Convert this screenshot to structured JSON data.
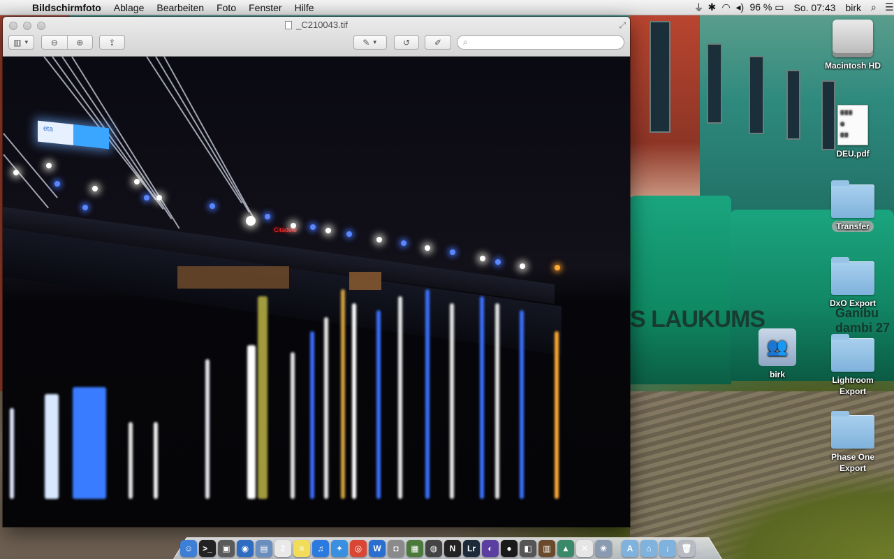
{
  "menubar": {
    "app_name": "Bildschirmfoto",
    "menus": [
      "Ablage",
      "Bearbeiten",
      "Foto",
      "Fenster",
      "Hilfe"
    ],
    "battery": "96 %",
    "clock": "So. 07:43",
    "user": "birk"
  },
  "window": {
    "title": "_C210043.tif",
    "search_placeholder": "",
    "photo_signs": {
      "sign_left": "eta",
      "sign_red": "Citadele"
    }
  },
  "desktop": {
    "wallpaper_text": "S LAUKUMS",
    "wallpaper_text2": "Ganibu dambi 27",
    "icons": [
      {
        "label": "Macintosh HD",
        "kind": "hd-icon"
      },
      {
        "label": "DEU.pdf",
        "kind": "pdf-icon"
      },
      {
        "label": "Transfer",
        "kind": "folder-icon"
      },
      {
        "label": "DxO Export",
        "kind": "folder-icon"
      },
      {
        "label": "birk",
        "kind": "home-icon"
      },
      {
        "label": "Lightroom Export",
        "kind": "folder-icon"
      },
      {
        "label": "Phase One Export",
        "kind": "folder-icon"
      }
    ]
  },
  "dock": {
    "apps": [
      {
        "name": "finder-icon",
        "glyph": "☺",
        "color": "#3d7fd6"
      },
      {
        "name": "terminal-icon",
        "glyph": ">_",
        "color": "#222"
      },
      {
        "name": "photo-booth-icon",
        "glyph": "▣",
        "color": "#5a5a5a"
      },
      {
        "name": "browser-icon",
        "glyph": "◉",
        "color": "#2d6cc0"
      },
      {
        "name": "preview-icon",
        "glyph": "▤",
        "color": "#6a8fbf"
      },
      {
        "name": "calendar-icon",
        "glyph": "2",
        "color": "#e9e9e9"
      },
      {
        "name": "notes-icon",
        "glyph": "≡",
        "color": "#f1dd5a"
      },
      {
        "name": "itunes-icon",
        "glyph": "♫",
        "color": "#2a7ae0"
      },
      {
        "name": "safari-icon",
        "glyph": "✦",
        "color": "#3b8fe0"
      },
      {
        "name": "chrome-icon",
        "glyph": "◎",
        "color": "#d94634"
      },
      {
        "name": "word-icon",
        "glyph": "W",
        "color": "#2a6ed0"
      },
      {
        "name": "camera-icon",
        "glyph": "◘",
        "color": "#8a8a8a"
      },
      {
        "name": "photo-app-icon",
        "glyph": "▦",
        "color": "#4c7a3c"
      },
      {
        "name": "aperture-icon",
        "glyph": "◍",
        "color": "#444"
      },
      {
        "name": "nikon-icon",
        "glyph": "N",
        "color": "#222"
      },
      {
        "name": "lightroom-icon",
        "glyph": "Lr",
        "color": "#1c2a3a"
      },
      {
        "name": "capture-one-icon",
        "glyph": "◐",
        "color": "#5a3ea0"
      },
      {
        "name": "dxo-icon",
        "glyph": "●",
        "color": "#1a1a1a"
      },
      {
        "name": "hdr-icon",
        "glyph": "◧",
        "color": "#555"
      },
      {
        "name": "filmstrip-icon",
        "glyph": "▥",
        "color": "#6a4a2a"
      },
      {
        "name": "landscape-icon",
        "glyph": "▲",
        "color": "#3a8a6a"
      },
      {
        "name": "image-tool-icon",
        "glyph": "✕",
        "color": "#e6e6e6"
      },
      {
        "name": "iphoto-icon",
        "glyph": "❀",
        "color": "#8a9ab0"
      },
      {
        "name": "applications-folder-icon",
        "glyph": "A",
        "color": "#7fb2dc"
      },
      {
        "name": "home-folder-icon",
        "glyph": "⌂",
        "color": "#7fb2dc"
      },
      {
        "name": "downloads-folder-icon",
        "glyph": "↓",
        "color": "#7fb2dc"
      },
      {
        "name": "trash-icon",
        "glyph": "🗑",
        "color": "#b8bcc2"
      }
    ]
  }
}
